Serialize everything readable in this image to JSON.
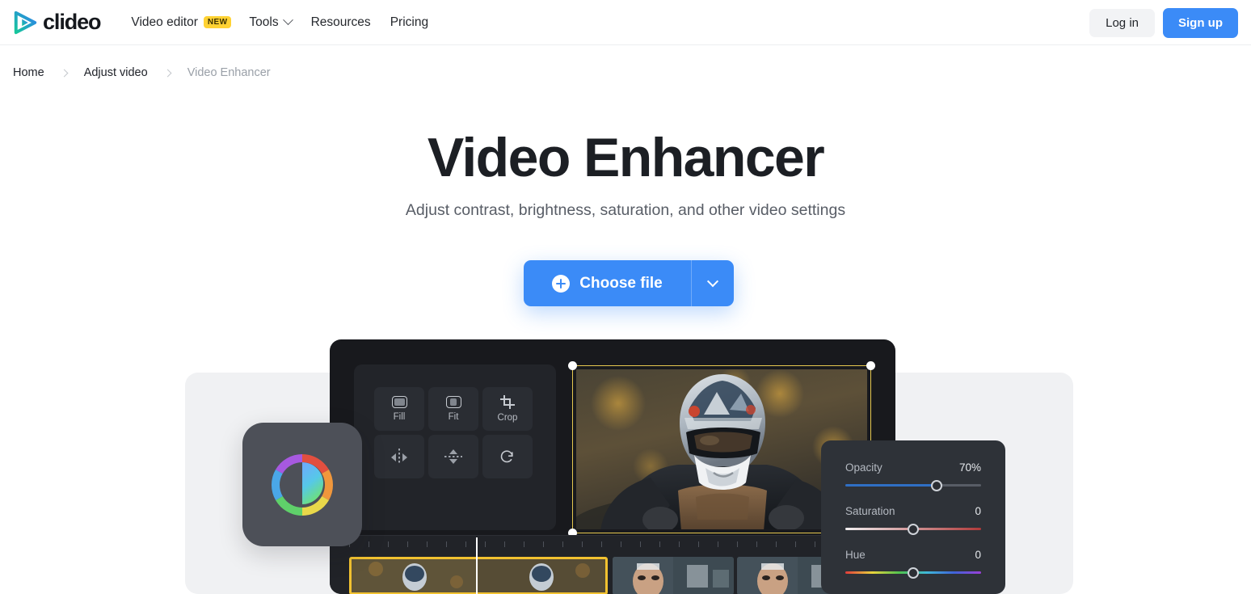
{
  "header": {
    "logo_text": "clideo",
    "logo_icon": "play-triangle-icon",
    "nav": [
      {
        "label": "Video editor",
        "badge": "NEW",
        "has_caret": false
      },
      {
        "label": "Tools",
        "badge": "",
        "has_caret": true
      },
      {
        "label": "Resources",
        "badge": "",
        "has_caret": false
      },
      {
        "label": "Pricing",
        "badge": "",
        "has_caret": false
      }
    ],
    "login_label": "Log in",
    "signup_label": "Sign up",
    "accent_color": "#3b8bf7",
    "badge_color": "#ffd233"
  },
  "breadcrumb": {
    "home": "Home",
    "section": "Adjust video",
    "current": "Video Enhancer"
  },
  "hero": {
    "title": "Video Enhancer",
    "subtitle": "Adjust contrast, brightness, saturation, and other video settings"
  },
  "cta": {
    "label": "Choose file",
    "plus_icon": "plus-circle-icon",
    "dropdown_icon": "chevron-down-icon"
  },
  "editor": {
    "tools": [
      {
        "label": "Fill",
        "icon": "fill-icon"
      },
      {
        "label": "Fit",
        "icon": "fit-icon"
      },
      {
        "label": "Crop",
        "icon": "crop-icon"
      },
      {
        "label": "",
        "icon": "flip-horizontal-icon"
      },
      {
        "label": "",
        "icon": "flip-vertical-icon"
      },
      {
        "label": "",
        "icon": "rotate-clockwise-icon"
      }
    ],
    "selection_frame_color": "#e6c84f",
    "clip_selected_color": "#f2c230"
  },
  "sliders": [
    {
      "name": "Opacity",
      "value": "70%",
      "position": 67
    },
    {
      "name": "Saturation",
      "value": "0",
      "position": 50
    },
    {
      "name": "Hue",
      "value": "0",
      "position": 50
    }
  ],
  "color_card": {
    "icon": "color-wheel-contrast-icon"
  }
}
